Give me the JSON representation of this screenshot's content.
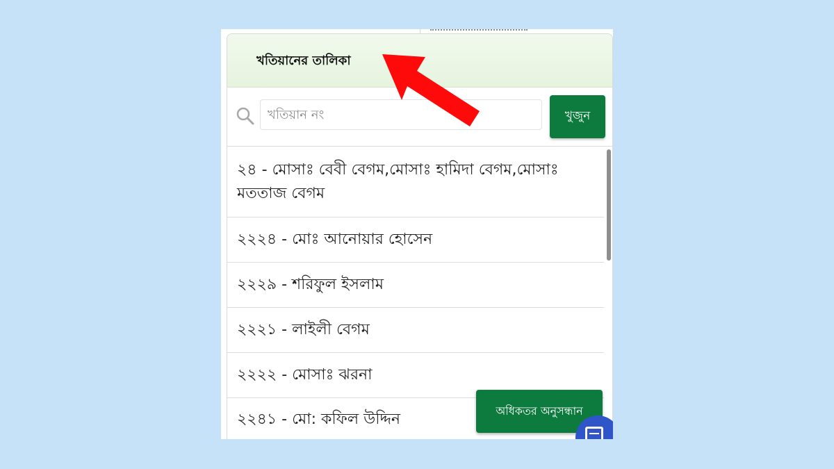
{
  "panel": {
    "title": "খতিয়ানের তালিকা"
  },
  "search": {
    "placeholder": "খতিয়ান নং",
    "value": "",
    "button_label": "খুজুন"
  },
  "results": [
    {
      "text": "২৪ - মোসাঃ বেবী বেগম,মোসাঃ হামিদা বেগম,মোসাঃ মততাজ বেগম"
    },
    {
      "text": "২২২৪ - মোঃ আনোয়ার হোসেন"
    },
    {
      "text": "২২২৯ - শরিফুল ইসলাম"
    },
    {
      "text": "২২২১ - লাইলী বেগম"
    },
    {
      "text": "২২২২ - মোসাঃ ঝরনা"
    },
    {
      "text": "২২৪১ - মো: কফিল উদ্দিন"
    }
  ],
  "advanced_search": {
    "label": "অধিকতর অনুসন্ধান"
  },
  "icons": {
    "search": "search-icon",
    "fab": "menu-list-icon",
    "annotation": "red-arrow-icon"
  },
  "colors": {
    "background": "#c5e2f8",
    "header": "#e6f4de",
    "button": "#0d7a3e",
    "fab": "#2f55c9",
    "arrow": "#ff0000"
  }
}
